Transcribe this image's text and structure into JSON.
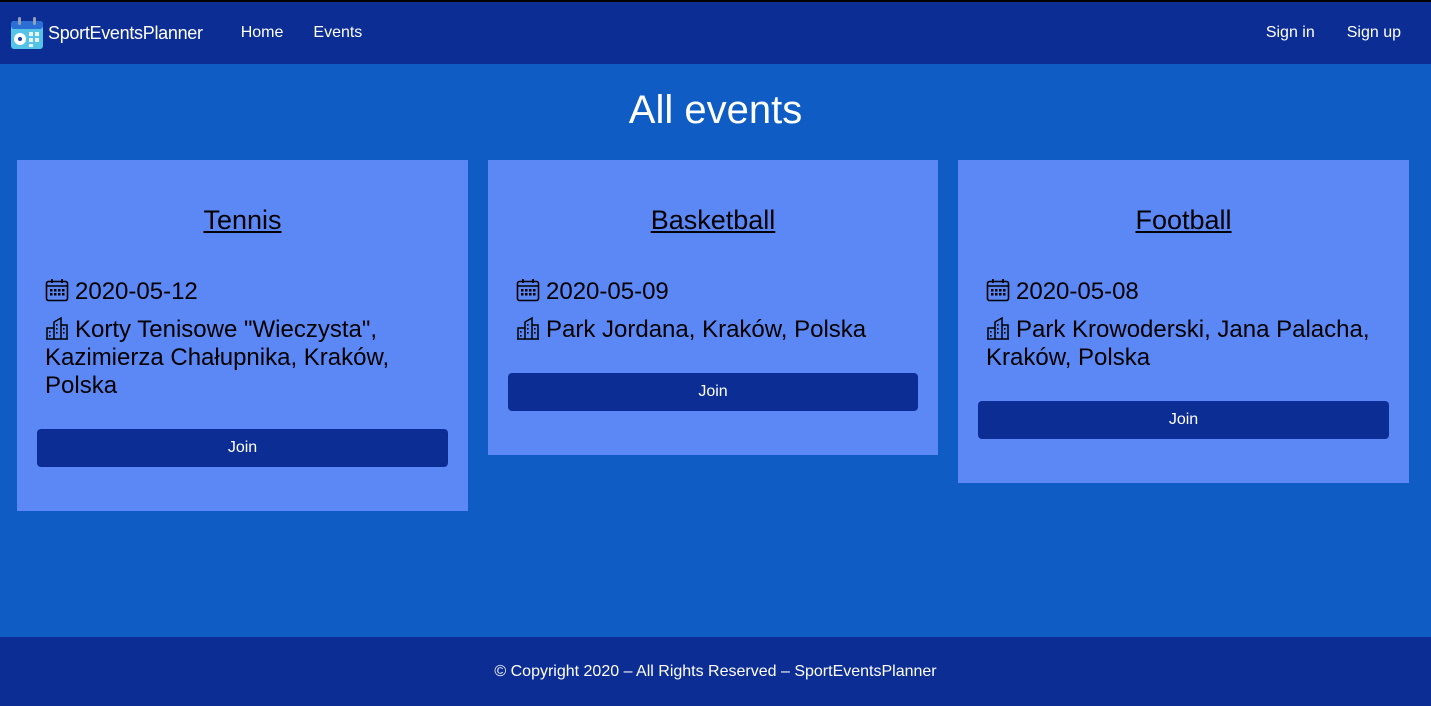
{
  "nav": {
    "brand": "SportEventsPlanner",
    "home": "Home",
    "events": "Events",
    "sign_in": "Sign in",
    "sign_up": "Sign up"
  },
  "page_title": "All events",
  "events": [
    {
      "title": "Tennis",
      "date": "2020-05-12",
      "location": "Korty Tenisowe \"Wieczysta\", Kazimierza Chałupnika, Kraków, Polska",
      "join_label": "Join"
    },
    {
      "title": "Basketball",
      "date": "2020-05-09",
      "location": "Park Jordana, Kraków, Polska",
      "join_label": "Join"
    },
    {
      "title": "Football",
      "date": "2020-05-08",
      "location": "Park Krowoderski, Jana Palacha, Kraków, Polska",
      "join_label": "Join"
    }
  ],
  "icons": {
    "logo": "calendar-logo-icon",
    "date": "calendar-icon",
    "location": "building-icon"
  },
  "colors": {
    "navbar": "#0c2d93",
    "page_background": "#0f5cc4",
    "card_background": "#5c88f5",
    "button": "#0c2d93"
  },
  "footer": {
    "text": "© Copyright 2020 – All Rights Reserved – SportEventsPlanner"
  }
}
